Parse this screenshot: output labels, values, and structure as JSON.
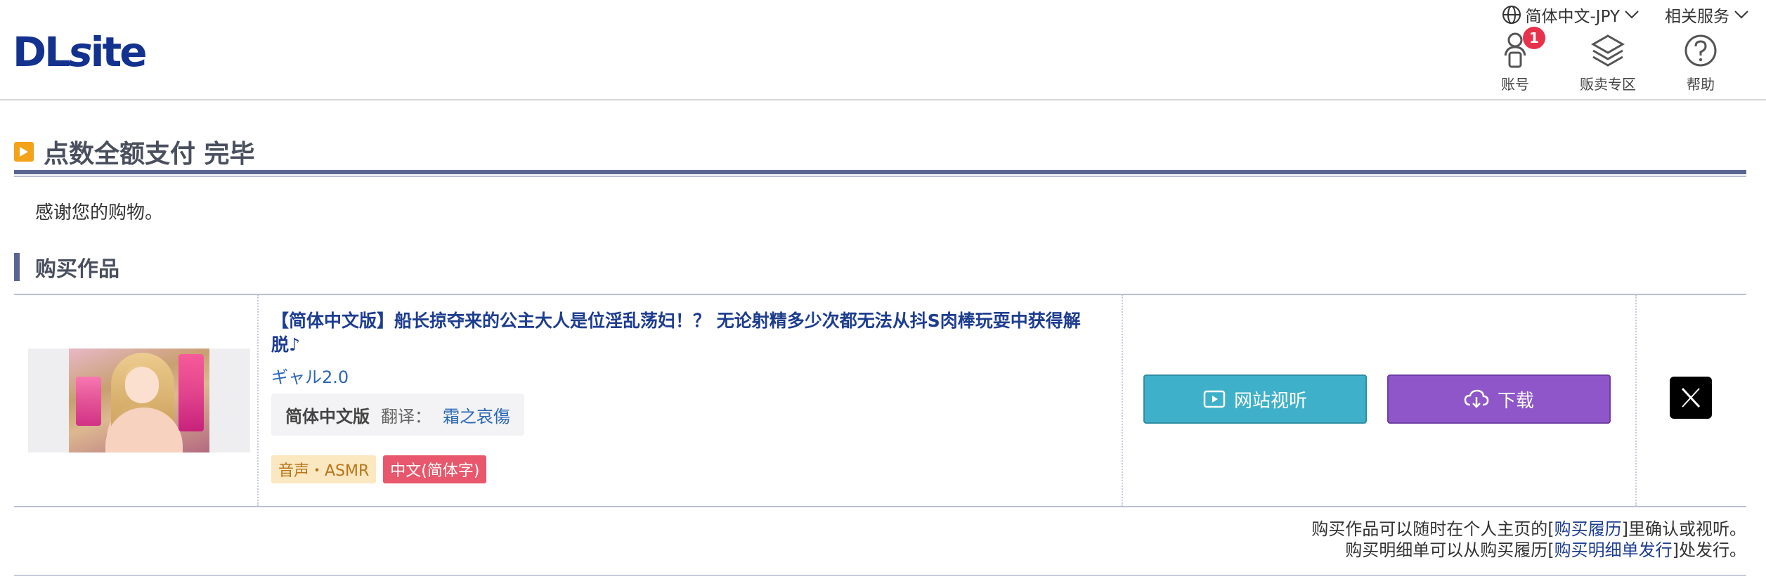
{
  "header": {
    "logo_text": "DLsite",
    "language": "简体中文-JPY",
    "related_services": "相关服务",
    "nav": [
      {
        "label": "账号",
        "icon": "account-icon",
        "badge": "1"
      },
      {
        "label": "贩卖专区",
        "icon": "layers-icon"
      },
      {
        "label": "帮助",
        "icon": "help-icon"
      }
    ]
  },
  "page": {
    "title": "点数全额支付 完毕",
    "thanks": "感谢您的购物。",
    "section_title": "购买作品"
  },
  "purchase": {
    "work_title": "【简体中文版】船长掠夺来的公主大人是位淫乱荡妇！？ 无论射精多少次都无法从抖S肉棒玩耍中获得解脱♪",
    "maker": "ギャル2.0",
    "edition": "简体中文版",
    "translation_label": "翻译：",
    "translator": "霜之哀傷",
    "tags": [
      "音声・ASMR",
      "中文(简体字)"
    ],
    "view_button": "网站视听",
    "download_button": "下载"
  },
  "notes": {
    "line1_prefix": "购买作品可以随时在个人主页的[",
    "line1_link": "购买履历",
    "line1_suffix": "]里确认或视听。",
    "line2_prefix": "购买明细单可以从购买履历[",
    "line2_link": "购买明细单发行",
    "line2_suffix": "]处发行。"
  },
  "colors": {
    "accent_navy": "#5b6690",
    "title_icon": "#f3a21a",
    "view_button": "#3fb0c9",
    "download_button": "#8e56c8",
    "badge": "#e8324b",
    "link": "#1d3d8f"
  }
}
